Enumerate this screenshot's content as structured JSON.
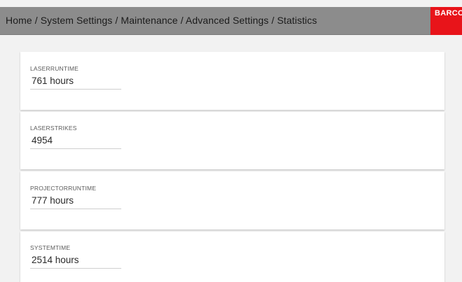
{
  "header": {
    "breadcrumb": "Home / System Settings / Maintenance / Advanced Settings / Statistics",
    "logo_text": "BARCO",
    "logo_color": "#e8141a"
  },
  "stats": [
    {
      "label": "LASERRUNTIME",
      "value": "761 hours"
    },
    {
      "label": "LASERSTRIKES",
      "value": "4954"
    },
    {
      "label": "PROJECTORRUNTIME",
      "value": "777 hours"
    },
    {
      "label": "SYSTEMTIME",
      "value": "2514 hours"
    }
  ]
}
